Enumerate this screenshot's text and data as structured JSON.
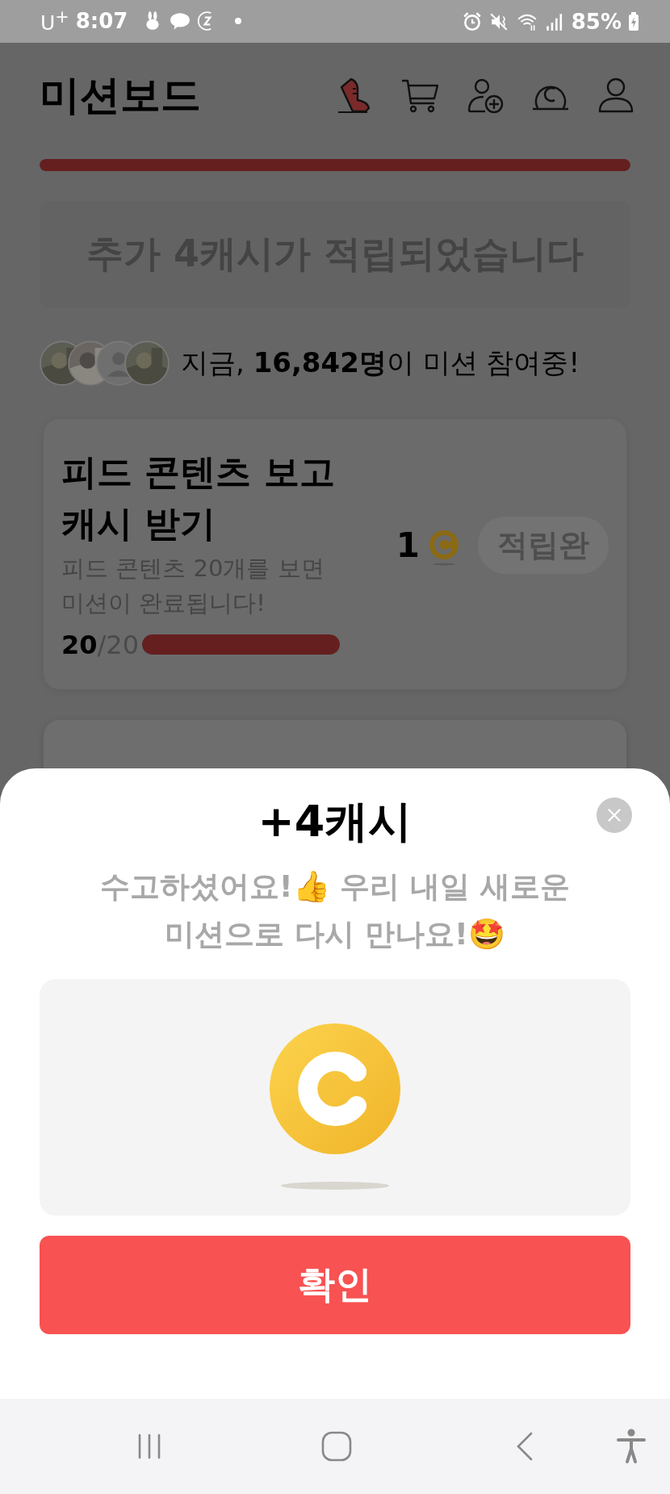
{
  "status_bar": {
    "carrier": "U$^{+}$",
    "time": "8:07",
    "battery": "85%"
  },
  "header": {
    "title": "미션보드",
    "progress": {
      "level": 1
    }
  },
  "banner": {
    "text": "추가 4캐시가 적립되었습니다"
  },
  "participants": {
    "avatars": [
      {
        "kind": "picture"
      },
      {
        "kind": "picture"
      },
      {
        "kind": "default"
      },
      {
        "kind": "picture"
      }
    ],
    "text": "지금, **16,842명**이 미션 참여중!"
  },
  "missions": [
    {
      "title": "피드 콘텐츠 보고 캐시 받기",
      "description": "피드 콘텐츠 20개를 보면 미션이 완료됩니다!",
      "current": "20",
      "total": "/20",
      "level": 1,
      "reward": "1",
      "button": "적립완",
      "disabled": true
    }
  ],
  "sheet": {
    "title": "+4캐시",
    "message": "수고하셨어요!👍 우리 내일 새로운 미션으로 다시 만나요!🤩",
    "confirm": "확인"
  }
}
